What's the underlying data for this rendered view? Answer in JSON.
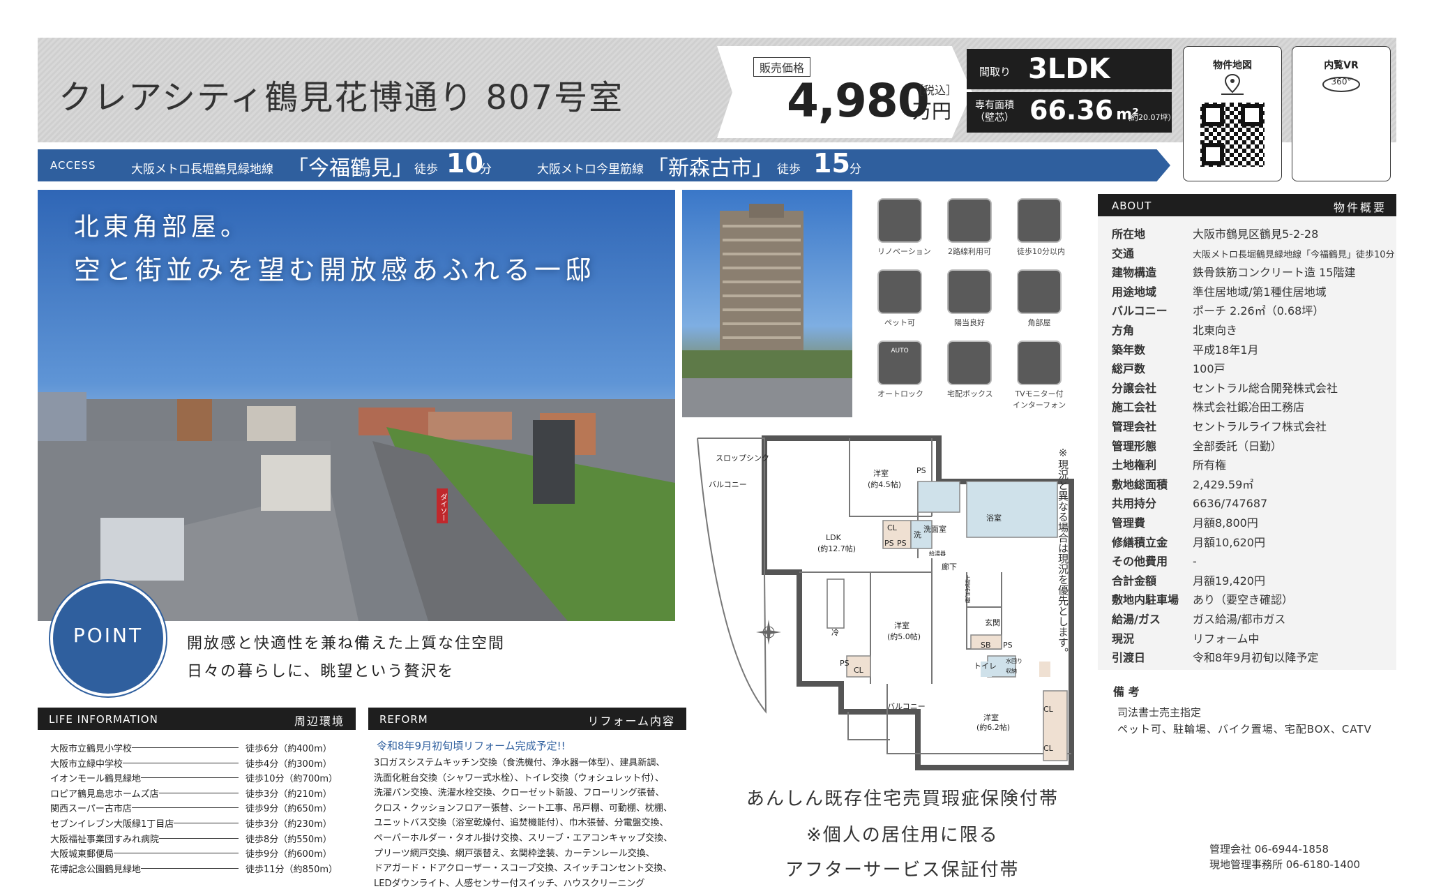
{
  "header": {
    "title": "クレアシティ鶴見花博通り 807号室",
    "price_label": "販売価格",
    "price": "4,980",
    "price_tax": "［税込］",
    "price_unit": "万円",
    "layout_label": "間取り",
    "layout": "3LDK",
    "area_label_1": "専有面積",
    "area_label_2": "（壁芯）",
    "area": "66.36",
    "area_unit": "m²",
    "area_tsubo": "（約20.07坪）",
    "map_label": "物件地図",
    "vr_label": "内覧VR",
    "vr_badge": "360°"
  },
  "access": {
    "label": "ACCESS",
    "line1": "大阪メトロ長堀鶴見緑地線",
    "station1": "「今福鶴見」",
    "walk1_pre": "徒歩",
    "walk1_min": "10",
    "walk1_unit": "分",
    "line2": "大阪メトロ今里筋線",
    "station2": "「新森古市」",
    "walk2_pre": "徒歩",
    "walk2_min": "15",
    "walk2_unit": "分"
  },
  "photo": {
    "caption_1": "北東角部屋。",
    "caption_2": "空と街並みを望む開放感あふれる一邸",
    "shop_sign": "ダイソー"
  },
  "features": [
    {
      "icon": "renovation-icon",
      "label": "リノベーション"
    },
    {
      "icon": "train-two-lines-icon",
      "label": "2路線利用可"
    },
    {
      "icon": "train-walk-icon",
      "label": "徒歩10分以内"
    },
    {
      "icon": "paw-icon",
      "label": "ペット可"
    },
    {
      "icon": "sun-icon",
      "label": "陽当良好"
    },
    {
      "icon": "corner-room-icon",
      "label": "角部屋"
    },
    {
      "icon": "autolock-icon",
      "label": "オートロック",
      "badge": "AUTO"
    },
    {
      "icon": "delivery-box-icon",
      "label": "宅配ボックス"
    },
    {
      "icon": "intercom-icon",
      "label": "TVモニター付インターフォン"
    }
  ],
  "floorplan": {
    "note": "※現況と異なる場合は現況を優先とします。",
    "labels": [
      "スロップシンク",
      "バルコニー",
      "洋室",
      "(約4.5帖)",
      "PS",
      "浴室",
      "洗面室",
      "CL",
      "PS",
      "PS",
      "洗",
      "LDK",
      "(約12.7帖)",
      "廊下",
      "洋室",
      "(約5.0帖)",
      "冷",
      "玄関",
      "SB",
      "PS",
      "トイレ",
      "PS",
      "CL",
      "バルコニー",
      "洋室",
      "(約6.2帖)",
      "CL",
      "CL"
    ],
    "legend": [
      "水回り",
      "収納"
    ],
    "side_labels": [
      "上部吊戸棚",
      "給湯器"
    ]
  },
  "warranty": {
    "line1": "あんしん既存住宅売買瑕疵保険付帯",
    "line2": "※個人の居住用に限る",
    "line3": "アフターサービス保証付帯"
  },
  "point": {
    "badge": "POINT",
    "line1": "開放感と快適性を兼ね備えた上質な住空間",
    "line2": "日々の暮らしに、眺望という贅沢を"
  },
  "life": {
    "title": "LIFE INFORMATION",
    "subtitle": "周辺環境",
    "items": [
      {
        "name": "大阪市立鶴見小学校",
        "dist": "徒歩6分（約400m）"
      },
      {
        "name": "大阪市立緑中学校",
        "dist": "徒歩4分（約300m）"
      },
      {
        "name": "イオンモール鶴見緑地",
        "dist": "徒歩10分（約700m）"
      },
      {
        "name": "ロピア鶴見島忠ホームズ店",
        "dist": "徒歩3分（約210m）"
      },
      {
        "name": "関西スーパー古市店",
        "dist": "徒歩9分（約650m）"
      },
      {
        "name": "セブンイレブン大阪緑1丁目店",
        "dist": "徒歩3分（約230m）"
      },
      {
        "name": "大阪福祉事業団すみれ病院",
        "dist": "徒歩8分（約550m）"
      },
      {
        "name": "大阪城東郵便局",
        "dist": "徒歩9分（約600m）"
      },
      {
        "name": "花博記念公園鶴見緑地",
        "dist": "徒歩11分（約850m）"
      }
    ]
  },
  "reform": {
    "title": "REFORM",
    "subtitle": "リフォーム内容",
    "headline": "令和8年9月初旬頃リフォーム完成予定!!",
    "lines": [
      "3口ガスシステムキッチン交換（食洗機付、浄水器一体型）、建具新調、",
      "洗面化粧台交換（シャワー式水栓）、トイレ交換（ウォシュレット付）、",
      "洗濯パン交換、洗濯水栓交換、クローゼット新設、フローリング張替、",
      "クロス・クッションフロアー張替、シート工事、吊戸棚、可動棚、枕棚、",
      "ユニットバス交換（浴室乾燥付、追焚機能付）、巾木張替、分電盤交換、",
      "ペーパーホルダー・タオル掛け交換、スリーブ・エアコンキャップ交換、",
      "プリーツ網戸交換、網戸張替え、玄関枠塗装、カーテンレール交換、",
      "ドアガード・ドアクローザー・スコープ交換、スイッチコンセント交換、",
      "LEDダウンライト、人感センサー付スイッチ、ハウスクリーニング"
    ]
  },
  "about": {
    "title": "ABOUT",
    "subtitle": "物件概要",
    "rows": [
      {
        "k": "所在地",
        "v": "大阪市鶴見区鶴見5-2-28"
      },
      {
        "k": "交通",
        "v": "大阪メトロ長堀鶴見緑地線「今福鶴見」徒歩10分"
      },
      {
        "k": "建物構造",
        "v": "鉄骨鉄筋コンクリート造 15階建"
      },
      {
        "k": "用途地域",
        "v": "準住居地域/第1種住居地域"
      },
      {
        "k": "バルコニー",
        "v": "ポーチ 2.26㎡（0.68坪）"
      },
      {
        "k": "方角",
        "v": "北東向き"
      },
      {
        "k": "築年数",
        "v": "平成18年1月"
      },
      {
        "k": "総戸数",
        "v": "100戸"
      },
      {
        "k": "分譲会社",
        "v": "セントラル総合開発株式会社"
      },
      {
        "k": "施工会社",
        "v": "株式会社鍛冶田工務店"
      },
      {
        "k": "管理会社",
        "v": "セントラルライフ株式会社"
      },
      {
        "k": "管理形態",
        "v": "全部委託（日勤）"
      },
      {
        "k": "土地権利",
        "v": "所有権"
      },
      {
        "k": "敷地総面積",
        "v": "2,429.59㎡"
      },
      {
        "k": "共用持分",
        "v": "6636/747687"
      },
      {
        "k": "管理費",
        "v": "月額8,800円"
      },
      {
        "k": "修繕積立金",
        "v": "月額10,620円"
      },
      {
        "k": "その他費用",
        "v": "-"
      },
      {
        "k": "合計金額",
        "v": "月額19,420円"
      },
      {
        "k": "敷地内駐車場",
        "v": "あり（要空き確認）"
      },
      {
        "k": "給湯/ガス",
        "v": "ガス給湯/都市ガス"
      },
      {
        "k": "現況",
        "v": "リフォーム中"
      },
      {
        "k": "引渡日",
        "v": "令和8年9月初旬以降予定"
      }
    ],
    "notes_title": "備 考",
    "notes_1": "司法書士売主指定",
    "notes_2": "ペット可、駐輪場、バイク置場、宅配BOX、CATV",
    "contact_1": "管理会社 06-6944-1858",
    "contact_2": "現地管理事務所 06-6180-1400"
  }
}
